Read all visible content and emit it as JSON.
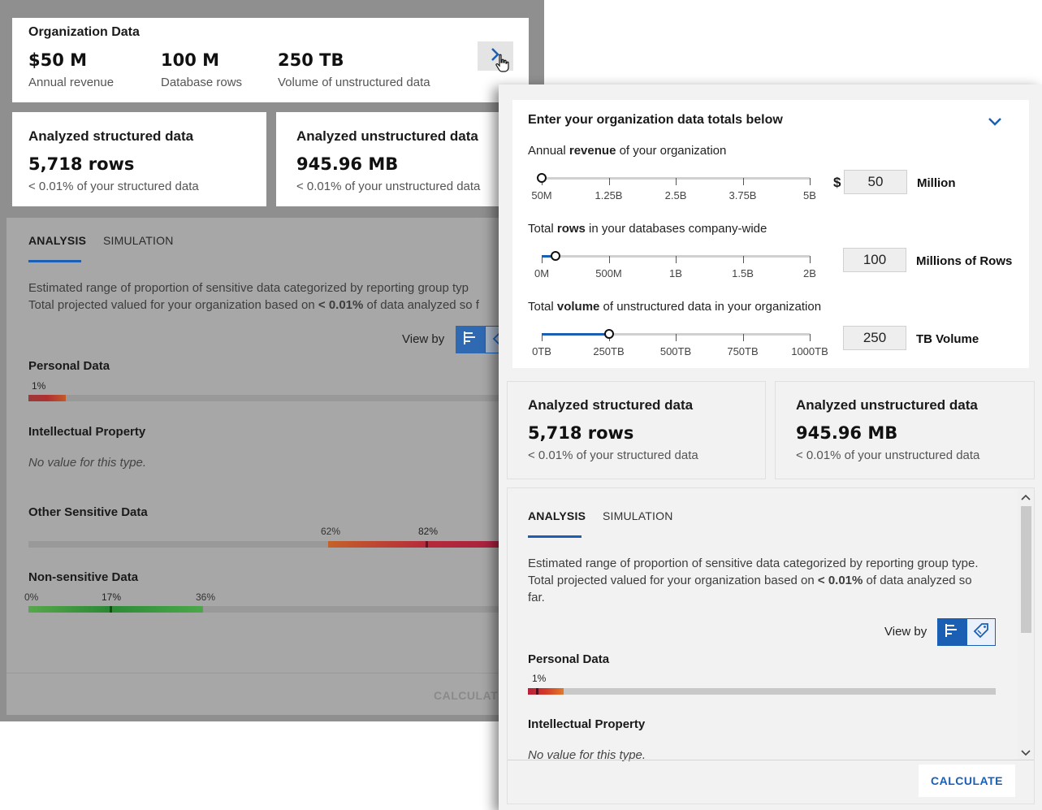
{
  "org_card": {
    "title": "Organization Data",
    "stats": [
      {
        "value": "$50 M",
        "label": "Annual revenue"
      },
      {
        "value": "100 M",
        "label": "Database rows"
      },
      {
        "value": "250 TB",
        "label": "Volume of unstructured data"
      }
    ]
  },
  "analyzed": {
    "structured": {
      "title": "Analyzed structured data",
      "value": "5,718 rows",
      "sub": "< 0.01% of your structured data"
    },
    "unstructured": {
      "title": "Analyzed unstructured data",
      "value": "945.96 MB",
      "sub": "< 0.01% of your unstructured data"
    }
  },
  "tabs": {
    "analysis": "ANALYSIS",
    "simulation": "SIMULATION"
  },
  "description_bg": {
    "line1": "Estimated range of proportion of sensitive data categorized by reporting group typ",
    "line2_pre": "Total projected valued for your organization based on ",
    "line2_bold": "< 0.01%",
    "line2_post": " of data analyzed so f"
  },
  "description_fg": {
    "pre": "Estimated range of proportion of sensitive data categorized by reporting group type. Total projected valued for your organization based on ",
    "bold": "< 0.01%",
    "post": " of data analyzed so far."
  },
  "view_by": "View by",
  "sections": {
    "personal": {
      "title": "Personal Data",
      "pct": "1%"
    },
    "ip": {
      "title": "Intellectual Property",
      "no_value": "No value for this type."
    },
    "other": {
      "title": "Other Sensitive Data",
      "low": "62%",
      "high": "82%"
    },
    "nonsensitive": {
      "title": "Non-sensitive Data",
      "low": "0%",
      "mid": "17%",
      "high": "36%"
    }
  },
  "calculate": "CALCULATE",
  "calculate_bg": "CALCULATE",
  "expanded": {
    "title": "Enter your organization data totals below",
    "revenue": {
      "label_pre": "Annual ",
      "label_bold": "revenue",
      "label_post": " of your organization",
      "ticks": [
        "50M",
        "1.25B",
        "2.5B",
        "3.75B",
        "5B"
      ],
      "currency": "$",
      "value": "50",
      "unit": "Million",
      "fraction": 0.0
    },
    "rows": {
      "label_pre": "Total ",
      "label_bold": "rows",
      "label_post": " in your databases company-wide",
      "ticks": [
        "0M",
        "500M",
        "1B",
        "1.5B",
        "2B"
      ],
      "value": "100",
      "unit": "Millions of Rows",
      "fraction": 0.05
    },
    "volume": {
      "label_pre": "Total ",
      "label_bold": "volume",
      "label_post": " of unstructured data in your organization",
      "ticks": [
        "0TB",
        "250TB",
        "500TB",
        "750TB",
        "1000TB"
      ],
      "value": "250",
      "unit": "TB Volume",
      "fraction": 0.25
    }
  },
  "colors": {
    "accent": "#1a5fb4",
    "heat_red": "#c2183f",
    "heat_orange": "#e0702a",
    "heat_green": "#3aa03a"
  },
  "icons": {
    "expand": "chevron-right-icon",
    "collapse": "chevron-down-icon",
    "bar": "bar-chart-icon",
    "tag": "tag-icon",
    "cursor": "hand-pointer-icon"
  }
}
